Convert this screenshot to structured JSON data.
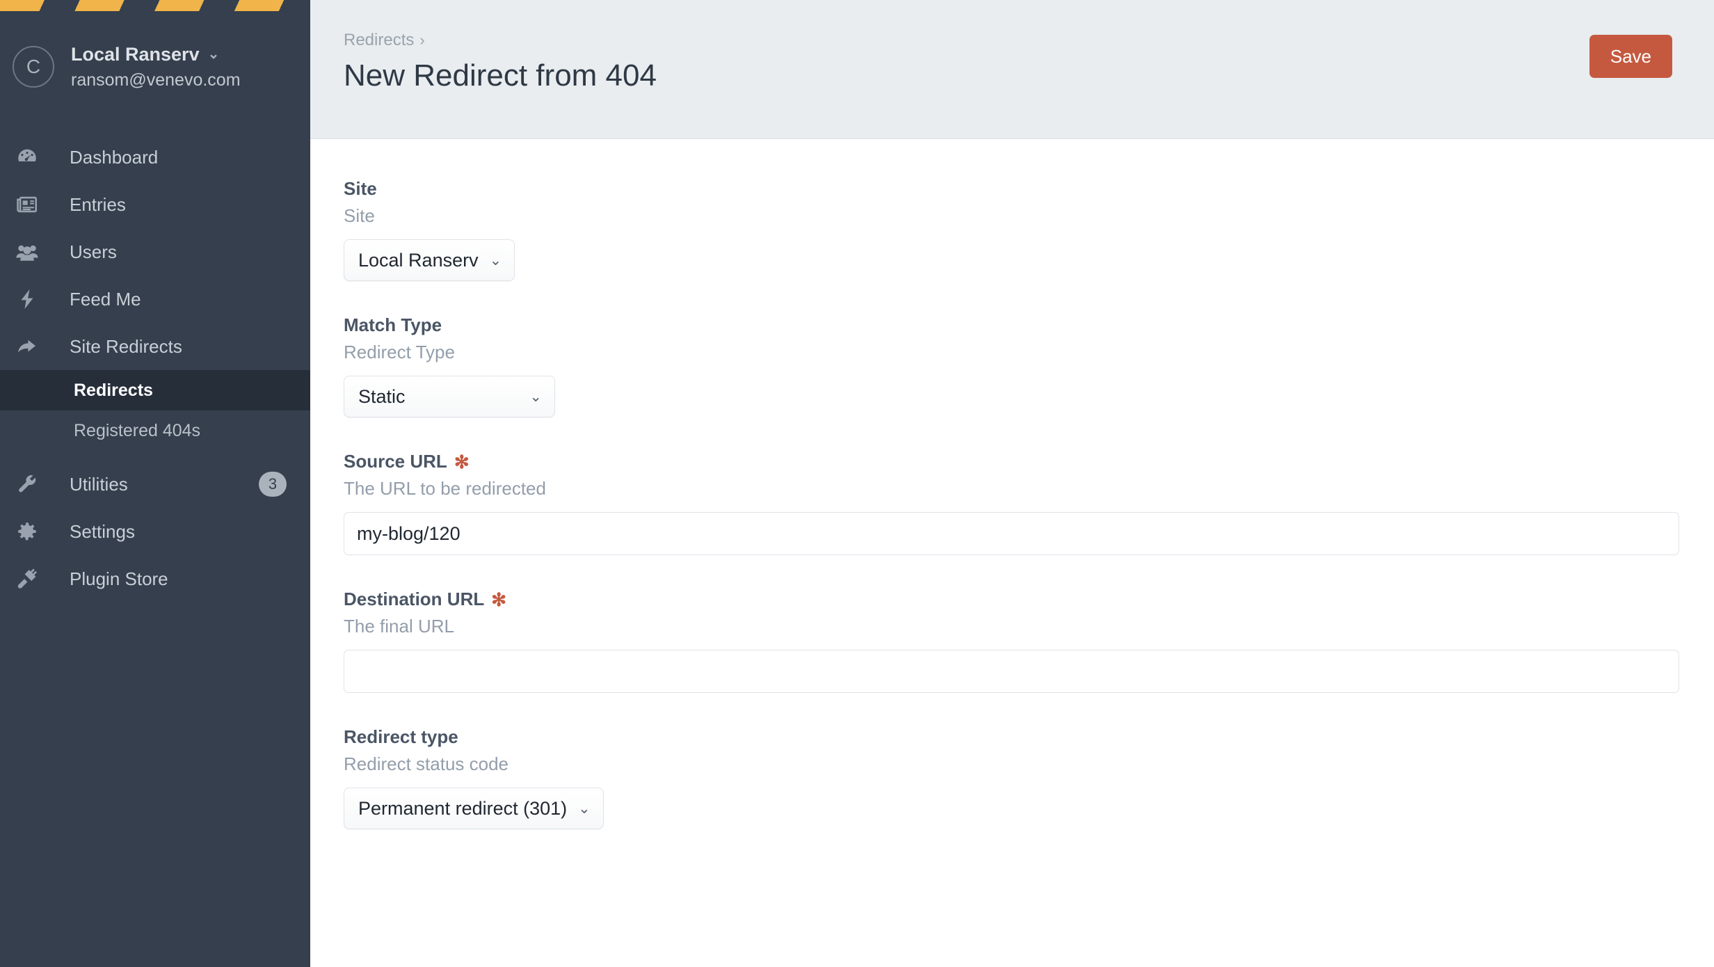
{
  "sidebar": {
    "account": {
      "avatar_initial": "C",
      "name": "Local Ranserv",
      "email": "ransom@venevo.com",
      "chevron": "⌄"
    },
    "nav": [
      {
        "label": "Dashboard",
        "icon": "gauge-icon",
        "badge": ""
      },
      {
        "label": "Entries",
        "icon": "newspaper-icon",
        "badge": ""
      },
      {
        "label": "Users",
        "icon": "users-icon",
        "badge": ""
      },
      {
        "label": "Feed Me",
        "icon": "bolt-icon",
        "badge": ""
      },
      {
        "label": "Site Redirects",
        "icon": "arrow-redirect-icon",
        "badge": ""
      }
    ],
    "subnav": [
      {
        "label": "Redirects",
        "active": true
      },
      {
        "label": "Registered 404s",
        "active": false
      }
    ],
    "nav_bottom": [
      {
        "label": "Utilities",
        "icon": "wrench-icon",
        "badge": "3"
      },
      {
        "label": "Settings",
        "icon": "gear-icon",
        "badge": ""
      },
      {
        "label": "Plugin Store",
        "icon": "plug-icon",
        "badge": ""
      }
    ]
  },
  "header": {
    "breadcrumb": "Redirects",
    "breadcrumb_separator": "›",
    "title": "New Redirect from 404",
    "save_label": "Save"
  },
  "form": {
    "site": {
      "heading": "Site",
      "instructions": "Site",
      "value": "Local Ranserv",
      "chevron": "⌄"
    },
    "match_type": {
      "heading": "Match Type",
      "instructions": "Redirect Type",
      "value": "Static",
      "chevron": "⌄"
    },
    "source_url": {
      "heading": "Source URL",
      "required_mark": "✻",
      "instructions": "The URL to be redirected",
      "value": "my-blog/120",
      "placeholder": ""
    },
    "destination_url": {
      "heading": "Destination URL",
      "required_mark": "✻",
      "instructions": "The final URL",
      "value": "",
      "placeholder": ""
    },
    "redirect_type": {
      "heading": "Redirect type",
      "instructions": "Redirect status code",
      "value": "Permanent redirect (301)",
      "chevron": "⌄"
    }
  },
  "colors": {
    "sidebar_bg": "#353f4d",
    "sidebar_active": "#262e3a",
    "header_bg": "#e9edf0",
    "accent_save": "#c5593f",
    "dev_stripe": "#f0b44a",
    "required_red": "#c5593f"
  }
}
